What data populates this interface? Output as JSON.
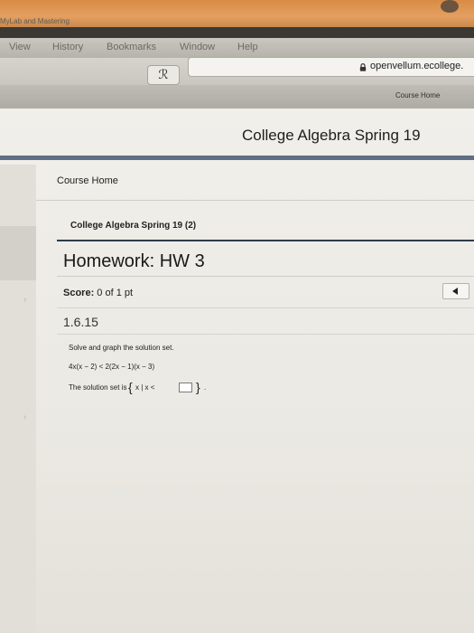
{
  "menu_bar": {
    "items": [
      "View",
      "History",
      "Bookmarks",
      "Window",
      "Help"
    ]
  },
  "toolbar": {
    "extension_glyph": "ℛ",
    "url": "openvellum.ecollege."
  },
  "tab_bar": {
    "left_label": "MyLab and Mastering",
    "course_home_button": "Course Home"
  },
  "header": {
    "title": "College Algebra Spring 19"
  },
  "breadcrumb": {
    "course_home": "Course Home",
    "course_name": "College Algebra Spring 19 (2)"
  },
  "homework": {
    "title": "Homework: HW 3",
    "score_label": "Score:",
    "score_value": " 0 of 1 pt",
    "question_number": "1.6.15",
    "instruction": "Solve and graph the solution set.",
    "inequality": "4x(x − 2) < 2(2x − 1)(x − 3)",
    "answer_prefix": "The solution set is",
    "set_open": "{",
    "set_body": "x | x <",
    "set_close": "}",
    "answer_suffix": "."
  },
  "colors": {
    "wall": "#d98b45",
    "header_rule": "#5e6f86",
    "title_rule": "#2d3a4b"
  }
}
